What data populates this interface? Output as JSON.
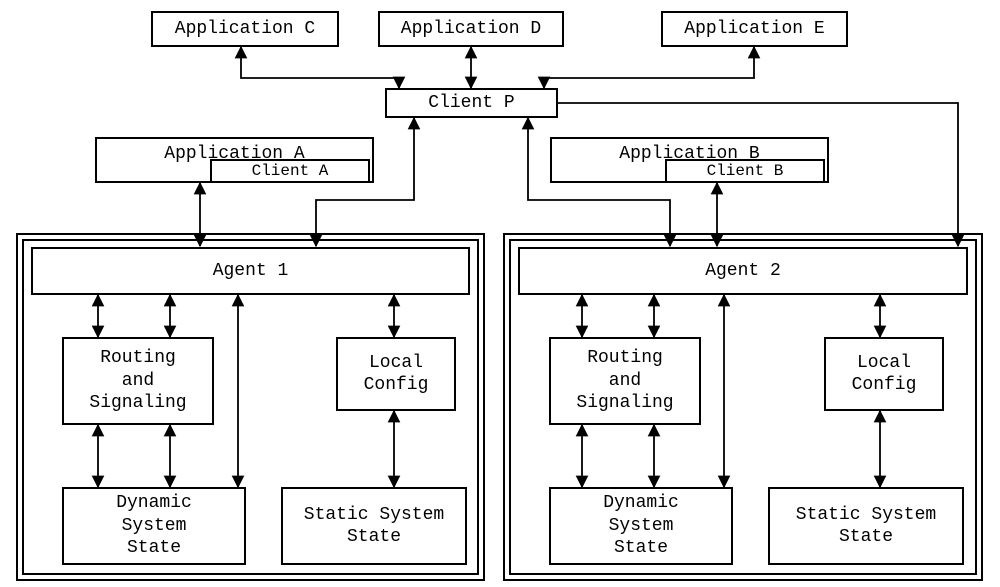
{
  "top": {
    "appC": "Application C",
    "appD": "Application D",
    "appE": "Application E",
    "clientP": "Client P"
  },
  "left": {
    "appA": "Application A",
    "clientA": "Client A",
    "agent": "Agent 1",
    "routing": "Routing\nand\nSignaling",
    "localConfig": "Local\nConfig",
    "dynState": "Dynamic\nSystem\nState",
    "statState": "Static System\nState"
  },
  "right": {
    "appB": "Application B",
    "clientB": "Client B",
    "agent": "Agent 2",
    "routing": "Routing\nand\nSignaling",
    "localConfig": "Local\nConfig",
    "dynState": "Dynamic\nSystem\nState",
    "statState": "Static System\nState"
  }
}
